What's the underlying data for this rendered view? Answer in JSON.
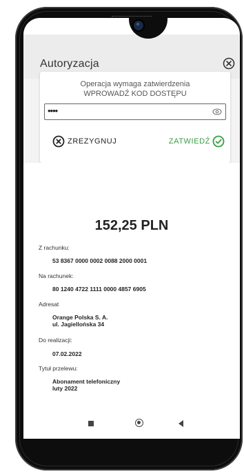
{
  "dialog": {
    "title": "Autoryzacja",
    "message": "Operacja wymaga zatwierdzenia",
    "prompt": "WPROWADŹ KOD DOSTĘPU",
    "password_value": "••••",
    "cancel_label": "ZREZYGNUJ",
    "confirm_label": "ZATWIEDŹ"
  },
  "transfer": {
    "amount": "152,25 PLN",
    "from_label": "Z rachunku:",
    "from_account": "53 8367 0000 0002 0088 2000 0001",
    "to_label": "Na rachunek:",
    "to_account": "80 1240 4722 1111 0000 4857 6905",
    "recipient_label": "Adresat",
    "recipient_line1": "Orange Polska S. A.",
    "recipient_line2": "ul. Jagiellońska 34",
    "date_label": "Do realizacji:",
    "date_value": "07.02.2022",
    "title_label": "Tytuł przelewu:",
    "title_line1": "Abonament telefoniczny",
    "title_line2": "luty 2022"
  },
  "colors": {
    "accent_green": "#3a9d44",
    "nav_accent": "#2e6bbd"
  },
  "icons": {
    "close": "close-circle-icon",
    "eye": "eye-icon",
    "cancel": "x-circle-icon",
    "confirm": "check-circle-icon",
    "nav_recent": "square-icon",
    "nav_home": "circle-icon",
    "nav_back": "triangle-back-icon"
  }
}
